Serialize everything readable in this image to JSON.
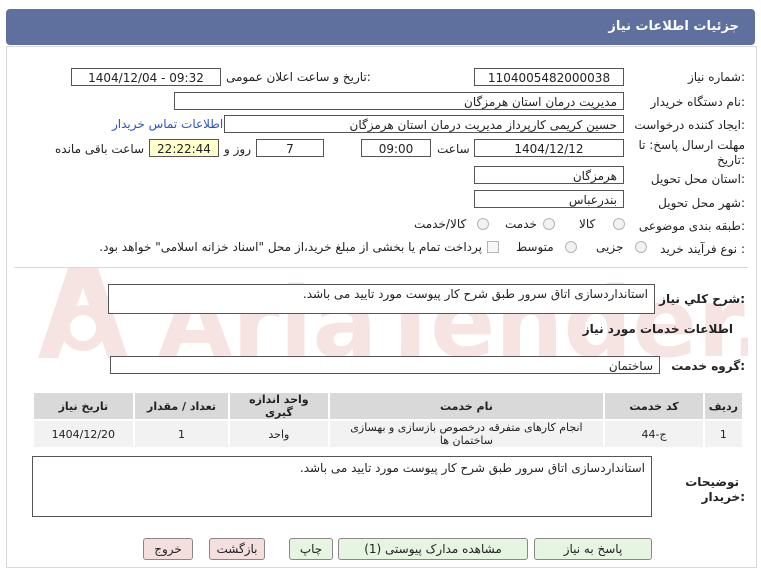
{
  "header": {
    "title": "جزئیات اطلاعات نیاز"
  },
  "form": {
    "need_number_label": "شماره نیاز:",
    "need_number": "1104005482000038",
    "announce_label": "تاریخ و ساعت اعلان عمومی:",
    "announce_value": "1404/12/04 - 09:32",
    "buyer_org_label": "نام دستگاه خریدار:",
    "buyer_org": "مدیریت درمان استان هرمزگان",
    "creator_label": "ایجاد کننده درخواست:",
    "creator": "حسین  کریمی کارپرداز مدیریت درمان استان هرمزگان",
    "contact_link": "اطلاعات تماس خریدار",
    "deadline_label_1": "مهلت ارسال پاسخ: تا",
    "deadline_label_2": "تاریخ:",
    "deadline_date": "1404/12/12",
    "time_label": "ساعت",
    "deadline_time": "09:00",
    "days_value": "7",
    "days_label": "روز و",
    "remaining_time": "22:22:44",
    "remaining_label": "ساعت باقی مانده",
    "province_label": "استان محل تحویل:",
    "province": "هرمزگان",
    "city_label": "شهر محل تحویل:",
    "city": "بندرعباس",
    "category_label": "طبقه بندی موضوعی:",
    "category_options": [
      "کالا",
      "خدمت",
      "کالا/خدمت"
    ],
    "purchase_type_label": "نوع فرآیند خرید :",
    "purchase_options": [
      "جزیی",
      "متوسط"
    ],
    "payment_note": "پرداخت تمام یا بخشی از مبلغ خرید،از محل \"اسناد خزانه اسلامی\" خواهد بود."
  },
  "description": {
    "label": "شرح كلي نياز:",
    "value": "استانداردسازی اتاق سرور طبق شرح کار پیوست مورد تایید می باشد."
  },
  "services": {
    "title": "اطلاعات خدمات مورد نیاز",
    "group_label": "گروه خدمت:",
    "group_value": "ساختمان",
    "columns": [
      "ردیف",
      "کد خدمت",
      "نام خدمت",
      "واحد اندازه گیری",
      "تعداد / مقدار",
      "تاریخ نیاز"
    ],
    "rows": [
      {
        "row": "1",
        "code": "ج-44",
        "name": "انجام کارهای متفرقه درخصوص بازسازی و بهسازی ساختمان ها",
        "unit": "واحد",
        "qty": "1",
        "date": "1404/12/20"
      }
    ]
  },
  "buyer_notes": {
    "label_1": "توضیحات",
    "label_2": "خریدار:",
    "value": "استانداردسازی اتاق سرور طبق شرح کار پیوست مورد تایید می باشد."
  },
  "buttons": {
    "reply": "پاسخ به نیاز",
    "docs": "مشاهده مدارک پیوستی (1)",
    "print": "چاپ",
    "back": "بازگشت",
    "exit": "خروج"
  },
  "watermark": {
    "brand": "AriaTender.net"
  },
  "colors": {
    "header": "#5f6f9e",
    "link": "#2a55c8",
    "button_green": "#e6f5e1",
    "button_pink": "#f4dede",
    "watermark": "#c0392b"
  }
}
